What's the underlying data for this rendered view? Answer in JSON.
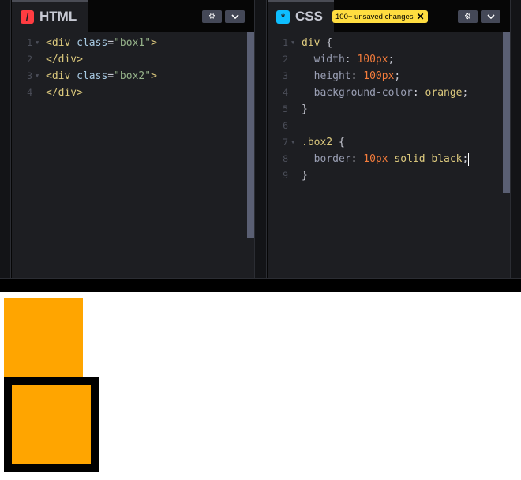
{
  "html_panel": {
    "title": "HTML",
    "icon": "html-slash-icon",
    "icon_glyph": "/",
    "lines": [
      {
        "num": "1",
        "fold": true,
        "parts": [
          {
            "t": "<div ",
            "c": "t-tag"
          },
          {
            "t": "class",
            "c": "t-attr"
          },
          {
            "t": "=",
            "c": "t-punc"
          },
          {
            "t": "\"box1\"",
            "c": "t-str"
          },
          {
            "t": ">",
            "c": "t-tag"
          }
        ]
      },
      {
        "num": "2",
        "fold": false,
        "parts": [
          {
            "t": "</div>",
            "c": "t-tag"
          }
        ]
      },
      {
        "num": "3",
        "fold": true,
        "parts": [
          {
            "t": "<div ",
            "c": "t-tag"
          },
          {
            "t": "class",
            "c": "t-attr"
          },
          {
            "t": "=",
            "c": "t-punc"
          },
          {
            "t": "\"box2\"",
            "c": "t-str"
          },
          {
            "t": ">",
            "c": "t-tag"
          }
        ]
      },
      {
        "num": "4",
        "fold": false,
        "parts": [
          {
            "t": "</div>",
            "c": "t-tag"
          }
        ]
      }
    ]
  },
  "css_panel": {
    "title": "CSS",
    "icon": "css-asterisk-icon",
    "icon_glyph": "*",
    "unsaved_badge": "100+ unsaved changes",
    "unsaved_close": "✕",
    "lines": [
      {
        "num": "1",
        "fold": true,
        "parts": [
          {
            "t": "div",
            "c": "t-sel"
          },
          {
            "t": " {",
            "c": "t-punc"
          }
        ]
      },
      {
        "num": "2",
        "fold": false,
        "parts": [
          {
            "t": "  width",
            "c": "t-prop"
          },
          {
            "t": ": ",
            "c": "t-punc"
          },
          {
            "t": "100px",
            "c": "t-num"
          },
          {
            "t": ";",
            "c": "t-punc"
          }
        ]
      },
      {
        "num": "3",
        "fold": false,
        "parts": [
          {
            "t": "  height",
            "c": "t-prop"
          },
          {
            "t": ": ",
            "c": "t-punc"
          },
          {
            "t": "100px",
            "c": "t-num"
          },
          {
            "t": ";",
            "c": "t-punc"
          }
        ]
      },
      {
        "num": "4",
        "fold": false,
        "parts": [
          {
            "t": "  background-color",
            "c": "t-prop"
          },
          {
            "t": ": ",
            "c": "t-punc"
          },
          {
            "t": "orange",
            "c": "t-val"
          },
          {
            "t": ";",
            "c": "t-punc"
          }
        ]
      },
      {
        "num": "5",
        "fold": false,
        "parts": [
          {
            "t": "}",
            "c": "t-punc"
          }
        ]
      },
      {
        "num": "6",
        "fold": false,
        "parts": []
      },
      {
        "num": "7",
        "fold": true,
        "parts": [
          {
            "t": ".box2",
            "c": "t-sel"
          },
          {
            "t": " {",
            "c": "t-punc"
          }
        ]
      },
      {
        "num": "8",
        "fold": false,
        "caret": true,
        "parts": [
          {
            "t": "  border",
            "c": "t-prop"
          },
          {
            "t": ": ",
            "c": "t-punc"
          },
          {
            "t": "10px",
            "c": "t-num"
          },
          {
            "t": " solid black",
            "c": "t-val"
          },
          {
            "t": ";",
            "c": "t-punc"
          }
        ]
      },
      {
        "num": "9",
        "fold": false,
        "parts": [
          {
            "t": "}",
            "c": "t-punc"
          }
        ]
      }
    ]
  },
  "buttons": {
    "settings_icon": "gear-icon",
    "settings_glyph": "⚙",
    "collapse_icon": "chevron-down-icon",
    "collapse_glyph": "⌄"
  },
  "colors": {
    "editor_bg": "#1d1e22",
    "badge_bg": "#ffdd40",
    "html_icon": "#ff3c41",
    "css_icon": "#0ebeff"
  },
  "preview": {
    "box1_color": "orange",
    "box2_color": "orange",
    "box2_border": "black"
  }
}
